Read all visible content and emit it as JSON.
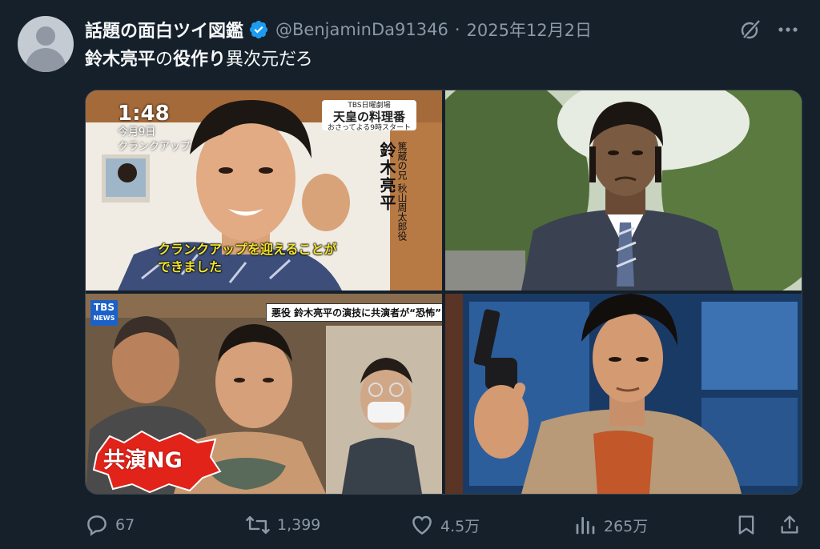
{
  "author": {
    "display_name": "話題の面白ツイ図鑑",
    "handle": "@BenjaminDa91346",
    "separator": "·",
    "date": "2025年12月2日",
    "verified": true
  },
  "tweet": {
    "text_parts": [
      {
        "text": "鈴木亮平",
        "bold": true
      },
      {
        "text": "の",
        "bold": false
      },
      {
        "text": "役作り",
        "bold": true
      },
      {
        "text": "異次元だろ",
        "bold": false
      }
    ]
  },
  "media": {
    "image1": {
      "clock": "1:48",
      "date_line1": "今月9日",
      "date_line2": "クランクアップ",
      "program_small": "おさってよる9時スタート",
      "program_title": "天皇の料理番",
      "program_top": "TBS日曜劇場",
      "person_name": "鈴木亮平",
      "role_line1": "篤蔵の兄",
      "role_line2": "秋山周太郎役",
      "caption_line1": "クランクアップを迎えることが",
      "caption_line2": "できました"
    },
    "image3": {
      "logo": "TBS",
      "logo_sub": "NEWS",
      "headline": "悪役 鈴木亮平の演技に共演者が“恐怖”",
      "badge": "共演NG"
    }
  },
  "actions": {
    "replies": "67",
    "retweets": "1,399",
    "likes": "4.5万",
    "views": "265万"
  },
  "colors": {
    "background": "#15202b",
    "text_primary": "#f7f9f9",
    "text_secondary": "#8b98a5",
    "verified_blue": "#1d9bf0",
    "caption_yellow": "#f3e52b"
  },
  "icons": {
    "verified": "verified-badge-icon",
    "grok": "grok-icon",
    "more": "more-dots-icon",
    "reply": "reply-icon",
    "retweet": "retweet-icon",
    "like": "heart-icon",
    "views": "views-chart-icon",
    "bookmark": "bookmark-icon",
    "share": "share-icon"
  }
}
